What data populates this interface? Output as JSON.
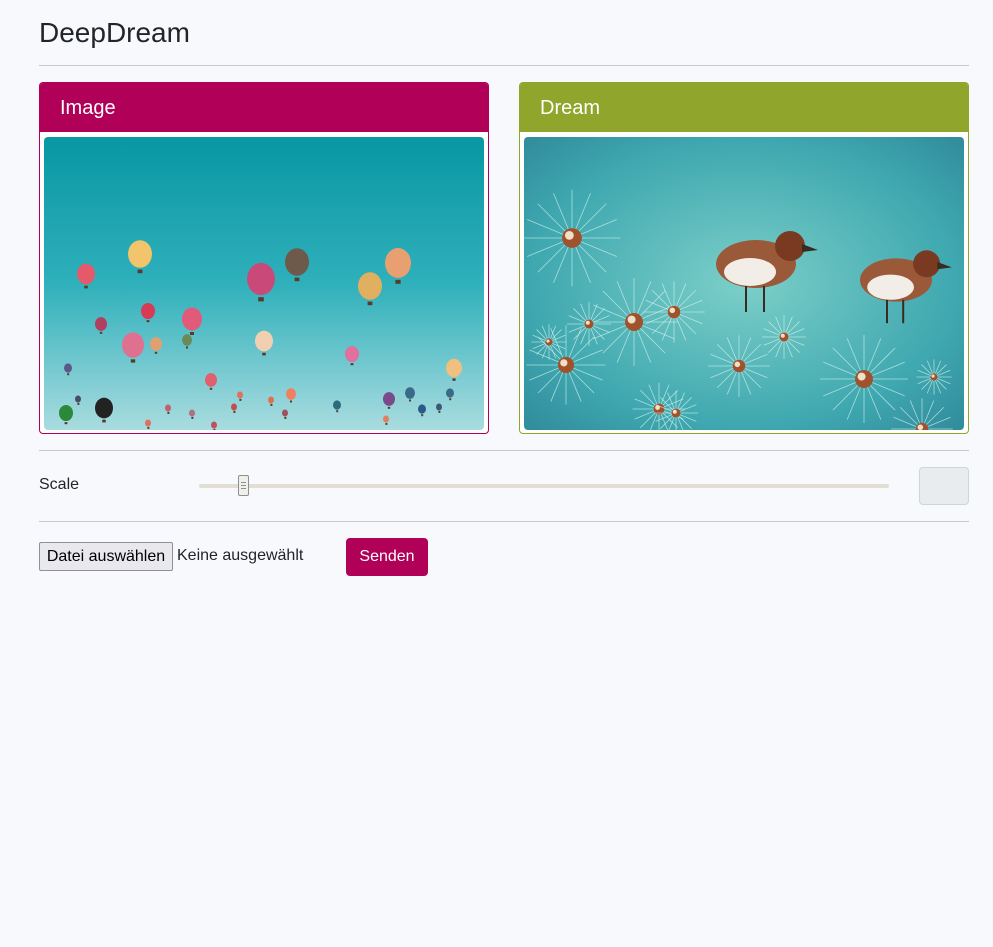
{
  "page": {
    "title": "DeepDream"
  },
  "colors": {
    "image_accent": "#b00057",
    "dream_accent": "#8fa52c",
    "background": "#f8f9fd"
  },
  "image_card": {
    "title": "Image",
    "content": "hot air balloons in a teal sky"
  },
  "dream_card": {
    "title": "Dream",
    "content": "deepdream rendering with bird shapes and radial patterns"
  },
  "scale": {
    "label": "Scale",
    "value_fraction": 0.064,
    "value_display": ""
  },
  "upload": {
    "button_label": "Datei auswählen",
    "status": "Keine ausgewählt"
  },
  "submit": {
    "label": "Senden"
  }
}
